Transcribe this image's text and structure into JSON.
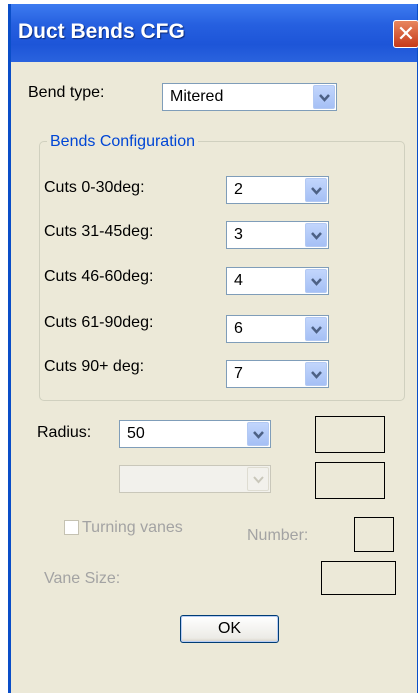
{
  "window": {
    "title": "Duct Bends CFG",
    "close_glyph": "✕"
  },
  "bend_type": {
    "label": "Bend type:",
    "value": "Mitered"
  },
  "group": {
    "title": "Bends Configuration",
    "rows": [
      {
        "label": "Cuts   0-30deg:",
        "value": "2"
      },
      {
        "label": "Cuts 31-45deg:",
        "value": "3"
      },
      {
        "label": "Cuts 46-60deg:",
        "value": "4"
      },
      {
        "label": "Cuts 61-90deg:",
        "value": "6"
      },
      {
        "label": "Cuts 90+ deg:",
        "value": "7"
      }
    ]
  },
  "radius": {
    "label": "Radius:",
    "value": "50",
    "secondary_value": ""
  },
  "turning_vanes": {
    "label": "Turning vanes",
    "checked": false
  },
  "number": {
    "label": "Number:"
  },
  "vane_size": {
    "label": "Vane Size:"
  },
  "ok_button": {
    "label": "OK"
  },
  "colors": {
    "titlebar": "#2660e0",
    "group_title": "#0046d5",
    "dialog_bg": "#ece9d8"
  }
}
